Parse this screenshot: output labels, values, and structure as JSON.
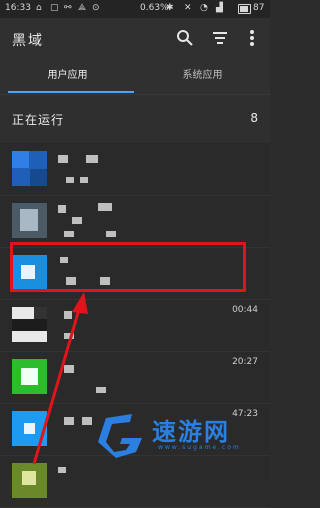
{
  "statusbar": {
    "time": "16:33",
    "network_speed": "0.63%",
    "battery": "87"
  },
  "appbar": {
    "title": "黑域",
    "icons": [
      "search-icon",
      "sort-icon",
      "more-vertical-icon"
    ]
  },
  "tabs": [
    {
      "label": "用户应用",
      "active": true
    },
    {
      "label": "系统应用",
      "active": false
    }
  ],
  "section": {
    "label": "正在运行",
    "count": "8"
  },
  "rows": [
    {
      "time": ""
    },
    {
      "time": ""
    },
    {
      "time": ""
    },
    {
      "time": "00:44"
    },
    {
      "time": "20:27"
    },
    {
      "time": "47:23"
    },
    {
      "time": ""
    }
  ],
  "watermark": {
    "text": "速游网",
    "url": "www.sugame.com"
  },
  "colors": {
    "accent": "#4aa3ff",
    "highlight": "#e0141b",
    "background": "#2a2a2a"
  }
}
